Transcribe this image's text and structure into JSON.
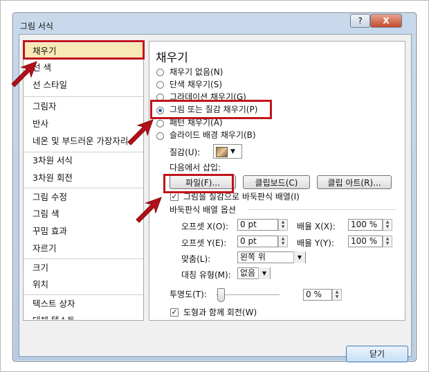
{
  "window": {
    "title": "그림 서식",
    "help_label": "?",
    "close_label": "X"
  },
  "nav": {
    "items": [
      {
        "label": "채우기",
        "selected": true
      },
      {
        "label": "선 색",
        "selected": false
      },
      {
        "label": "선 스타일",
        "selected": false
      },
      {
        "label": "그림자",
        "selected": false
      },
      {
        "label": "반사",
        "selected": false
      },
      {
        "label": "네온 및 부드러운 가장자리",
        "selected": false
      },
      {
        "label": "3차원 서식",
        "selected": false
      },
      {
        "label": "3차원 회전",
        "selected": false
      },
      {
        "label": "그림 수정",
        "selected": false
      },
      {
        "label": "그림 색",
        "selected": false
      },
      {
        "label": "꾸밈 효과",
        "selected": false
      },
      {
        "label": "자르기",
        "selected": false
      },
      {
        "label": "크기",
        "selected": false
      },
      {
        "label": "위치",
        "selected": false
      },
      {
        "label": "텍스트 상자",
        "selected": false
      },
      {
        "label": "대체 텍스트",
        "selected": false
      }
    ]
  },
  "panel": {
    "heading": "채우기",
    "radios": [
      {
        "label": "채우기 없음(N)",
        "checked": false
      },
      {
        "label": "단색 채우기(S)",
        "checked": false
      },
      {
        "label": "그라데이션 채우기(G)",
        "checked": false
      },
      {
        "label": "그림 또는 질감 채우기(P)",
        "checked": true
      },
      {
        "label": "패턴 채우기(A)",
        "checked": false
      },
      {
        "label": "슬라이드 배경 채우기(B)",
        "checked": false
      }
    ],
    "texture_label": "질감(U):",
    "insert_from_label": "다음에서 삽입:",
    "buttons": {
      "file": "파일(F)...",
      "clipboard": "클립보드(C)",
      "clipart": "클립 아트(R)..."
    },
    "tile_checkbox_label": "그림을 질감으로 바둑판식 배열(I)",
    "tile_checked": true,
    "tile_options_label": "바둑판식 배열 옵션",
    "offset_x_label": "오프셋 X(O):",
    "offset_x_value": "0 pt",
    "scale_x_label": "배율 X(X):",
    "scale_x_value": "100 %",
    "offset_y_label": "오프셋 Y(E):",
    "offset_y_value": "0 pt",
    "scale_y_label": "배율 Y(Y):",
    "scale_y_value": "100 %",
    "align_label": "맞춤(L):",
    "align_value": "왼쪽 위",
    "mirror_label": "대칭 유형(M):",
    "mirror_value": "없음",
    "transparency_label": "투명도(T):",
    "transparency_value": "0 %",
    "transparency_level": 0,
    "rotate_checkbox_label": "도형과 함께 회전(W)",
    "rotate_checked": true
  },
  "footer": {
    "close_label": "닫기"
  },
  "colors": {
    "highlight": "#c0141b",
    "selected_nav": "#f8e9b6"
  }
}
